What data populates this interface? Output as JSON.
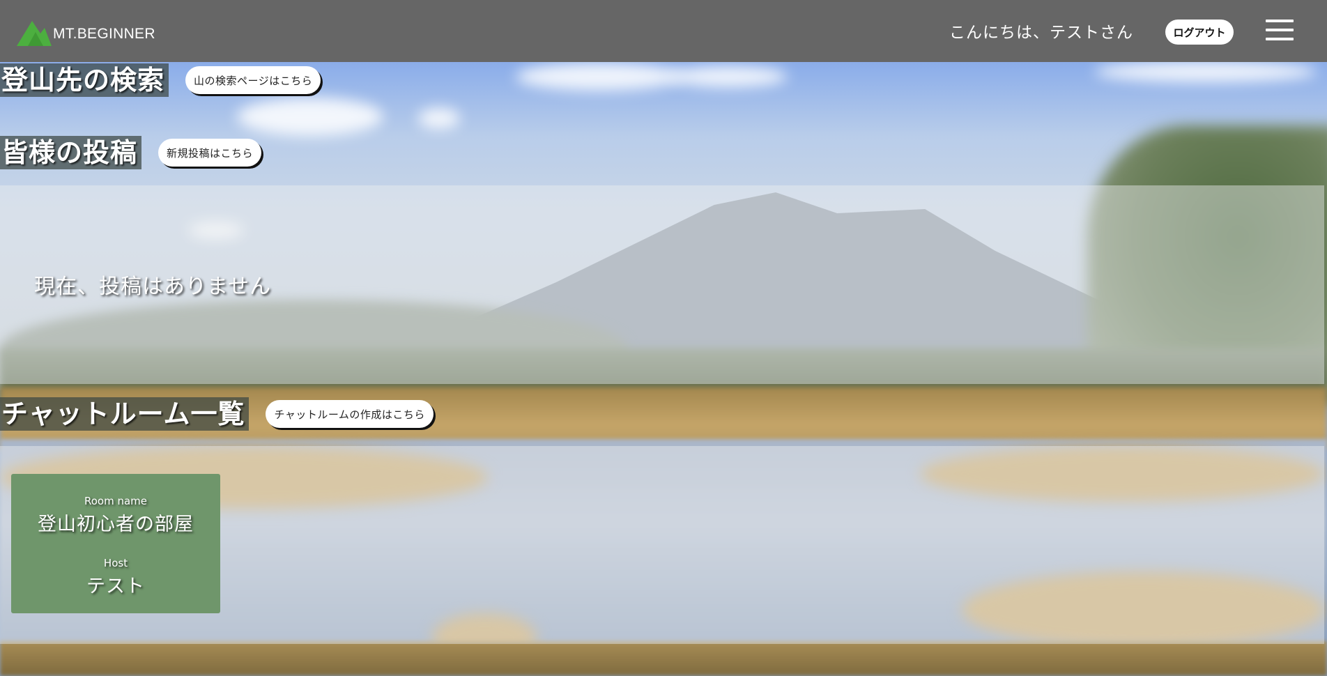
{
  "header": {
    "logo_text": "MT.BEGINNER",
    "greeting": "こんにちは、テストさん",
    "logout_label": "ログアウト",
    "menu_icon": "hamburger-menu-icon",
    "logo_icon": "mountain-logo-icon",
    "logo_color": "#4caf3f",
    "background": "#666666"
  },
  "search_section": {
    "heading": "登山先の検索",
    "button_label": "山の検索ページはこちら"
  },
  "posts_section": {
    "heading": "皆様の投稿",
    "button_label": "新規投稿はこちら",
    "empty_message": "現在、投稿はありません"
  },
  "chat_section": {
    "heading": "チャットルーム一覧",
    "button_label": "チャットルームの作成はこちら",
    "rooms": [
      {
        "room_label": "Room name",
        "room_name": "登山初心者の部屋",
        "host_label": "Host",
        "host_name": "テスト",
        "card_color": "#6f966b"
      }
    ]
  }
}
